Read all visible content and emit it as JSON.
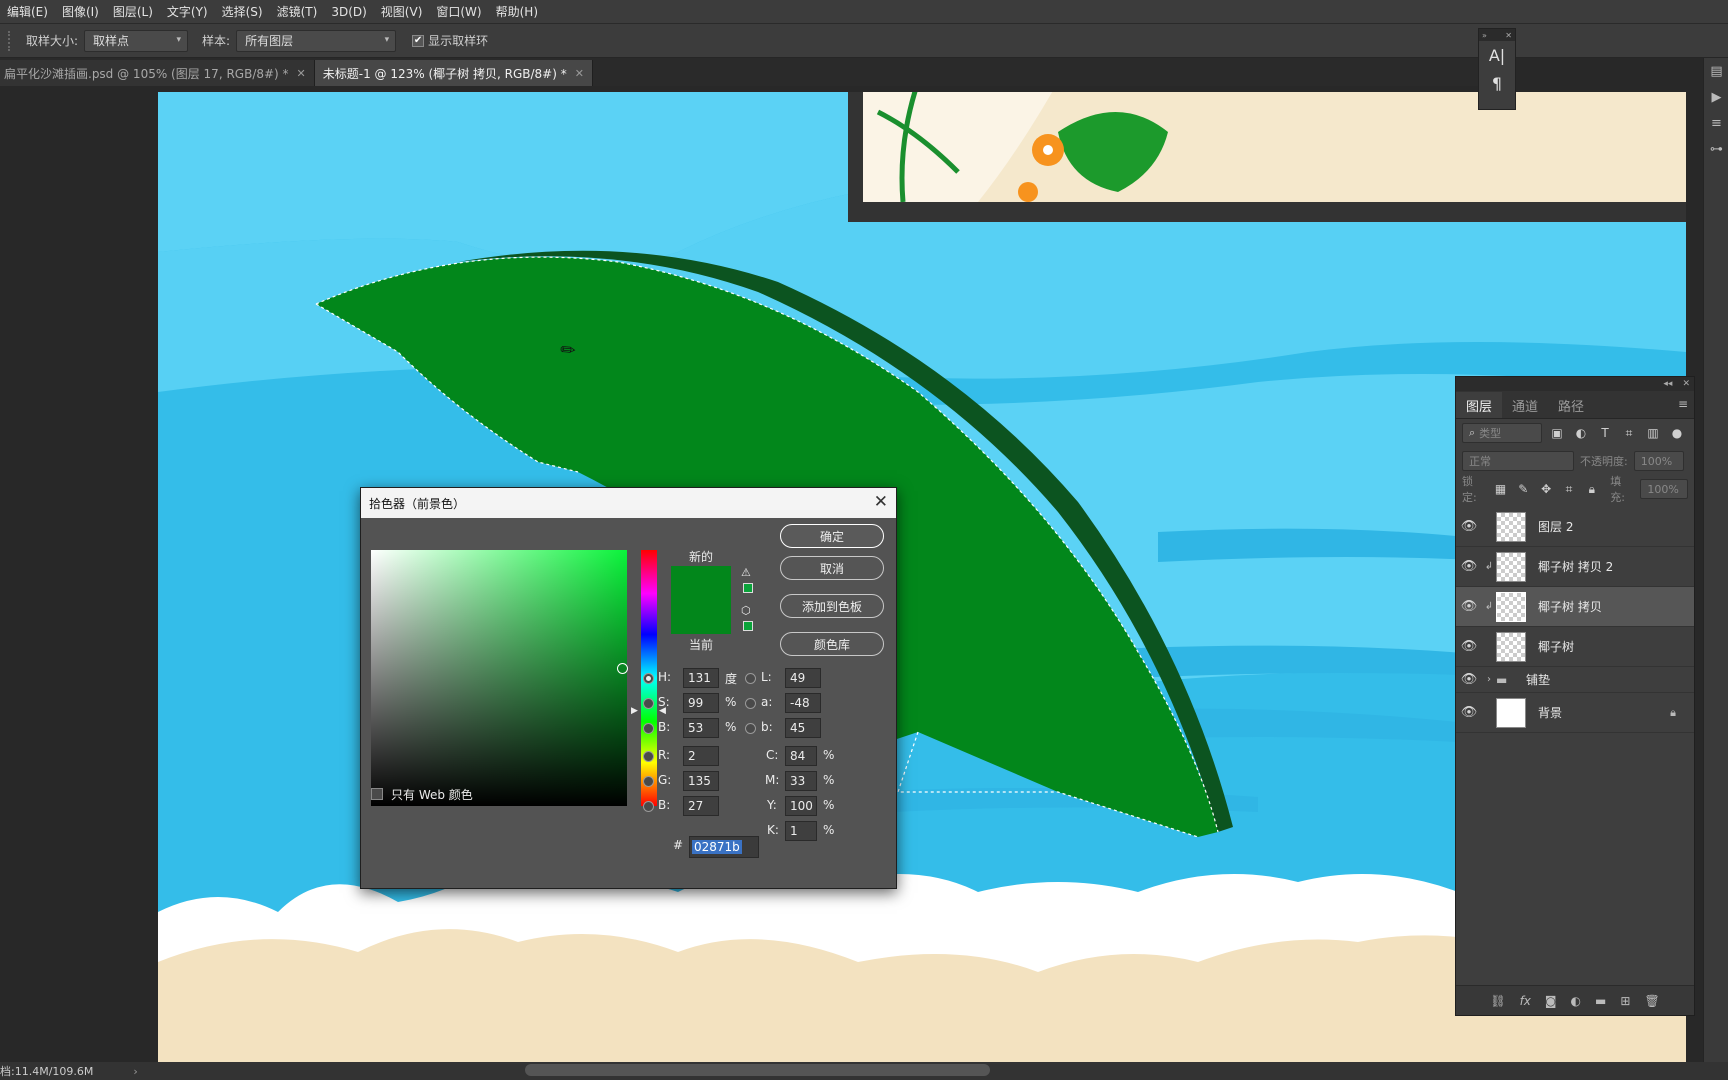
{
  "menu": [
    "编辑(E)",
    "图像(I)",
    "图层(L)",
    "文字(Y)",
    "选择(S)",
    "滤镜(T)",
    "3D(D)",
    "视图(V)",
    "窗口(W)",
    "帮助(H)"
  ],
  "options": {
    "sample_size_label": "取样大小:",
    "sample_size_value": "取样点",
    "sample_label": "样本:",
    "sample_value": "所有图层",
    "show_ring_label": "显示取样环"
  },
  "tabs": [
    {
      "label": "扁平化沙滩插画.psd @ 105% (图层 17, RGB/8#) *",
      "active": false
    },
    {
      "label": "未标题-1 @ 123% (椰子树 拷贝, RGB/8#) *",
      "active": true
    }
  ],
  "type_panel": {
    "char_icon": "A|",
    "para_icon": "¶"
  },
  "layers_panel": {
    "tabs": [
      "图层",
      "通道",
      "路径"
    ],
    "filter_placeholder": "类型",
    "blend_mode": "正常",
    "opacity_label": "不透明度:",
    "opacity_value": "100%",
    "lock_label": "锁定:",
    "fill_label": "填充:",
    "fill_value": "100%",
    "layers": [
      {
        "name": "图层 2",
        "selected": false,
        "clipped": false,
        "type": "layer"
      },
      {
        "name": "椰子树 拷贝 2",
        "selected": false,
        "clipped": true,
        "type": "layer"
      },
      {
        "name": "椰子树 拷贝",
        "selected": true,
        "clipped": true,
        "type": "layer"
      },
      {
        "name": "椰子树",
        "selected": false,
        "clipped": false,
        "type": "layer"
      },
      {
        "name": "铺垫",
        "selected": false,
        "clipped": false,
        "type": "group"
      },
      {
        "name": "背景",
        "selected": false,
        "clipped": false,
        "type": "background"
      }
    ]
  },
  "status": {
    "doc_size": "档:11.4M/109.6M"
  },
  "picker": {
    "title": "拾色器（前景色）",
    "new_label": "新的",
    "current_label": "当前",
    "ok": "确定",
    "cancel": "取消",
    "add_swatch": "添加到色板",
    "color_libraries": "颜色库",
    "web_only": "只有 Web 颜色",
    "H": {
      "label": "H:",
      "value": "131",
      "unit": "度"
    },
    "S": {
      "label": "S:",
      "value": "99",
      "unit": "%"
    },
    "B": {
      "label": "B:",
      "value": "53",
      "unit": "%"
    },
    "R": {
      "label": "R:",
      "value": "2"
    },
    "G": {
      "label": "G:",
      "value": "135"
    },
    "Bb": {
      "label": "B:",
      "value": "27"
    },
    "L": {
      "label": "L:",
      "value": "49"
    },
    "a": {
      "label": "a:",
      "value": "-48"
    },
    "b": {
      "label": "b:",
      "value": "45"
    },
    "C": {
      "label": "C:",
      "value": "84",
      "unit": "%"
    },
    "M": {
      "label": "M:",
      "value": "33",
      "unit": "%"
    },
    "Y": {
      "label": "Y:",
      "value": "100",
      "unit": "%"
    },
    "K": {
      "label": "K:",
      "value": "1",
      "unit": "%"
    },
    "hex_label": "#",
    "hex": "02871b",
    "color": "#02871b"
  }
}
